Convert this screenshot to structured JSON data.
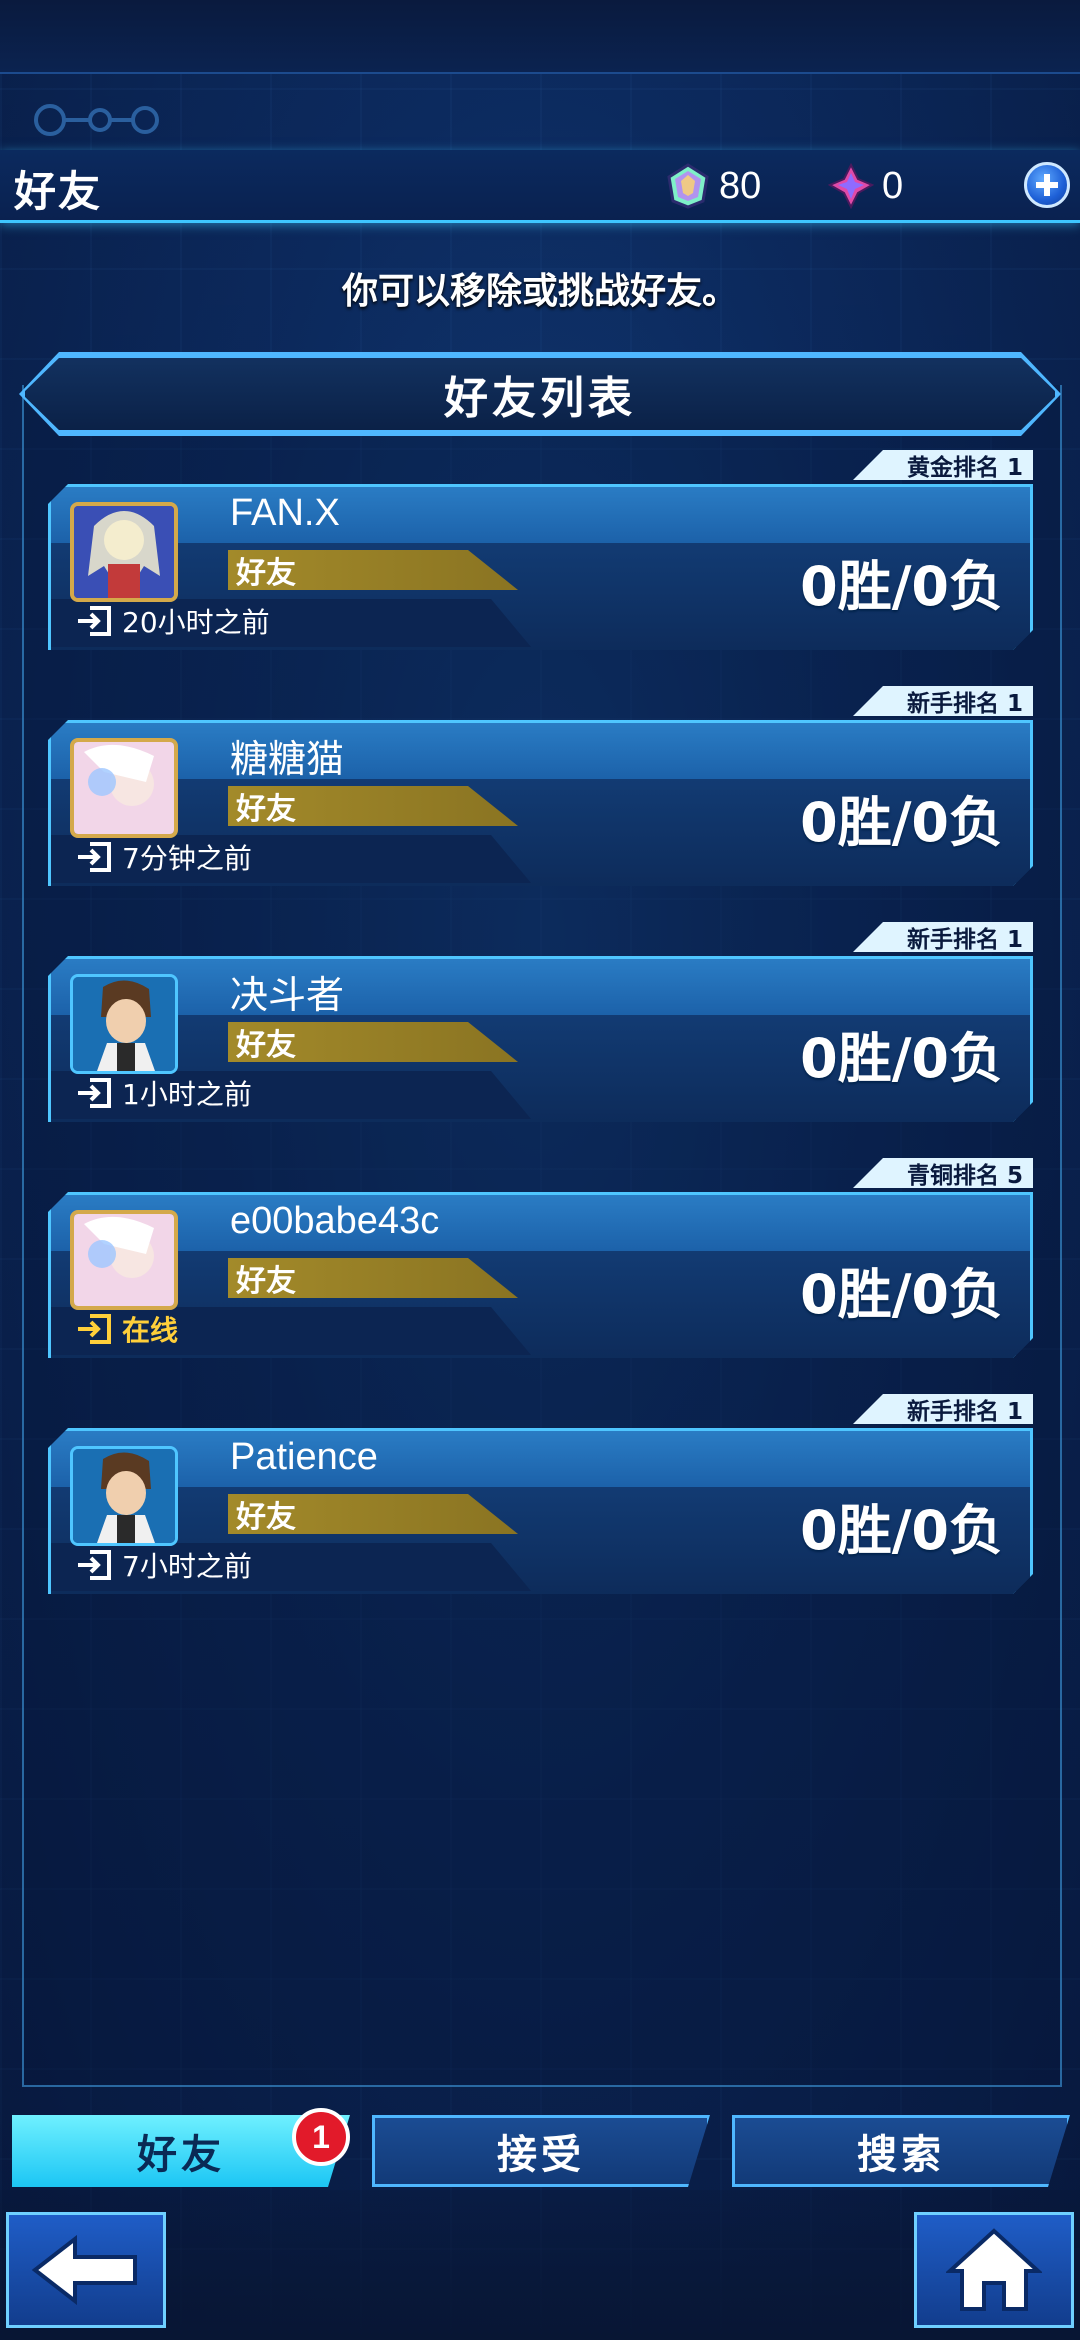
{
  "header": {
    "title": "好友",
    "gems": "80",
    "crystals": "0"
  },
  "subtitle": "你可以移除或挑战好友。",
  "list_title": "好友列表",
  "friends": [
    {
      "rank": "黄金排名 1",
      "name": "FAN.X",
      "tag": "好友",
      "last_login": "20小时之前",
      "record": "0胜/0负",
      "online": false,
      "avatar": "gold-frame-portrait"
    },
    {
      "rank": "新手排名 1",
      "name": "糖糖猫",
      "tag": "好友",
      "last_login": "7分钟之前",
      "record": "0胜/0负",
      "online": false,
      "avatar": "gold-frame-portrait"
    },
    {
      "rank": "新手排名 1",
      "name": "决斗者",
      "tag": "好友",
      "last_login": "1小时之前",
      "record": "0胜/0负",
      "online": false,
      "avatar": "plain-portrait"
    },
    {
      "rank": "青铜排名 5",
      "name": "e00babe43c",
      "tag": "好友",
      "last_login": "在线",
      "record": "0胜/0负",
      "online": true,
      "avatar": "gold-frame-portrait"
    },
    {
      "rank": "新手排名 1",
      "name": "Patience",
      "tag": "好友",
      "last_login": "7小时之前",
      "record": "0胜/0负",
      "online": false,
      "avatar": "plain-portrait"
    }
  ],
  "tabs": [
    {
      "label": "好友",
      "active": true
    },
    {
      "label": "接受",
      "active": false
    },
    {
      "label": "搜索",
      "active": false
    }
  ],
  "badge_count": "1",
  "colors": {
    "accent": "#4fc6ff",
    "gold_bar": "#a38a2a",
    "online": "#ffcf3a",
    "badge": "#e21a2a"
  }
}
